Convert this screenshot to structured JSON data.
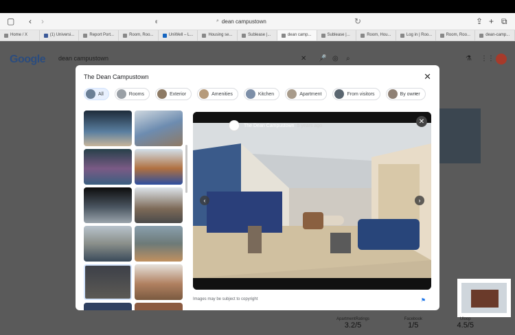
{
  "browser": {
    "url": "dean campustown",
    "tabs": [
      "Home / X",
      "(1) Universi...",
      "Report Port...",
      "Room, Roo...",
      "UniWell – L...",
      "Housing se...",
      "Sublease |...",
      "dean camp...",
      "Sublease |...",
      "Room, Hou...",
      "Log in | Roo...",
      "Room, Roo...",
      "dean-camp..."
    ]
  },
  "google": {
    "logo": "Google",
    "search_query": "dean campustown",
    "ratings": [
      {
        "value": "3.2/5",
        "label": "ApartmentRatings"
      },
      {
        "value": "1/5",
        "label": "Facebook"
      },
      {
        "value": "4.5/5",
        "label": "Uloop"
      }
    ]
  },
  "modal": {
    "title": "The Dean Campustown",
    "chips": [
      "All",
      "Rooms",
      "Exterior",
      "Amenities",
      "Kitchen",
      "Apartment",
      "From visitors",
      "By owner"
    ],
    "viewer": {
      "source": "The Dean Campustown",
      "age": "5 years ago"
    },
    "copyright": "Images may be subject to copyright"
  }
}
